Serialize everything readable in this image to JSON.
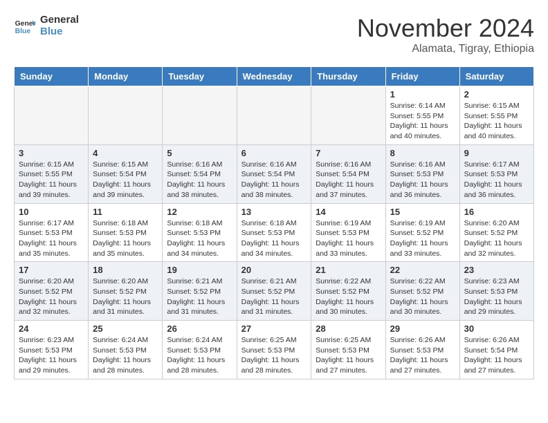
{
  "header": {
    "logo_line1": "General",
    "logo_line2": "Blue",
    "month_title": "November 2024",
    "location": "Alamata, Tigray, Ethiopia"
  },
  "weekdays": [
    "Sunday",
    "Monday",
    "Tuesday",
    "Wednesday",
    "Thursday",
    "Friday",
    "Saturday"
  ],
  "weeks": [
    [
      {
        "day": "",
        "info": ""
      },
      {
        "day": "",
        "info": ""
      },
      {
        "day": "",
        "info": ""
      },
      {
        "day": "",
        "info": ""
      },
      {
        "day": "",
        "info": ""
      },
      {
        "day": "1",
        "info": "Sunrise: 6:14 AM\nSunset: 5:55 PM\nDaylight: 11 hours\nand 40 minutes."
      },
      {
        "day": "2",
        "info": "Sunrise: 6:15 AM\nSunset: 5:55 PM\nDaylight: 11 hours\nand 40 minutes."
      }
    ],
    [
      {
        "day": "3",
        "info": "Sunrise: 6:15 AM\nSunset: 5:55 PM\nDaylight: 11 hours\nand 39 minutes."
      },
      {
        "day": "4",
        "info": "Sunrise: 6:15 AM\nSunset: 5:54 PM\nDaylight: 11 hours\nand 39 minutes."
      },
      {
        "day": "5",
        "info": "Sunrise: 6:16 AM\nSunset: 5:54 PM\nDaylight: 11 hours\nand 38 minutes."
      },
      {
        "day": "6",
        "info": "Sunrise: 6:16 AM\nSunset: 5:54 PM\nDaylight: 11 hours\nand 38 minutes."
      },
      {
        "day": "7",
        "info": "Sunrise: 6:16 AM\nSunset: 5:54 PM\nDaylight: 11 hours\nand 37 minutes."
      },
      {
        "day": "8",
        "info": "Sunrise: 6:16 AM\nSunset: 5:53 PM\nDaylight: 11 hours\nand 36 minutes."
      },
      {
        "day": "9",
        "info": "Sunrise: 6:17 AM\nSunset: 5:53 PM\nDaylight: 11 hours\nand 36 minutes."
      }
    ],
    [
      {
        "day": "10",
        "info": "Sunrise: 6:17 AM\nSunset: 5:53 PM\nDaylight: 11 hours\nand 35 minutes."
      },
      {
        "day": "11",
        "info": "Sunrise: 6:18 AM\nSunset: 5:53 PM\nDaylight: 11 hours\nand 35 minutes."
      },
      {
        "day": "12",
        "info": "Sunrise: 6:18 AM\nSunset: 5:53 PM\nDaylight: 11 hours\nand 34 minutes."
      },
      {
        "day": "13",
        "info": "Sunrise: 6:18 AM\nSunset: 5:53 PM\nDaylight: 11 hours\nand 34 minutes."
      },
      {
        "day": "14",
        "info": "Sunrise: 6:19 AM\nSunset: 5:53 PM\nDaylight: 11 hours\nand 33 minutes."
      },
      {
        "day": "15",
        "info": "Sunrise: 6:19 AM\nSunset: 5:52 PM\nDaylight: 11 hours\nand 33 minutes."
      },
      {
        "day": "16",
        "info": "Sunrise: 6:20 AM\nSunset: 5:52 PM\nDaylight: 11 hours\nand 32 minutes."
      }
    ],
    [
      {
        "day": "17",
        "info": "Sunrise: 6:20 AM\nSunset: 5:52 PM\nDaylight: 11 hours\nand 32 minutes."
      },
      {
        "day": "18",
        "info": "Sunrise: 6:20 AM\nSunset: 5:52 PM\nDaylight: 11 hours\nand 31 minutes."
      },
      {
        "day": "19",
        "info": "Sunrise: 6:21 AM\nSunset: 5:52 PM\nDaylight: 11 hours\nand 31 minutes."
      },
      {
        "day": "20",
        "info": "Sunrise: 6:21 AM\nSunset: 5:52 PM\nDaylight: 11 hours\nand 31 minutes."
      },
      {
        "day": "21",
        "info": "Sunrise: 6:22 AM\nSunset: 5:52 PM\nDaylight: 11 hours\nand 30 minutes."
      },
      {
        "day": "22",
        "info": "Sunrise: 6:22 AM\nSunset: 5:52 PM\nDaylight: 11 hours\nand 30 minutes."
      },
      {
        "day": "23",
        "info": "Sunrise: 6:23 AM\nSunset: 5:53 PM\nDaylight: 11 hours\nand 29 minutes."
      }
    ],
    [
      {
        "day": "24",
        "info": "Sunrise: 6:23 AM\nSunset: 5:53 PM\nDaylight: 11 hours\nand 29 minutes."
      },
      {
        "day": "25",
        "info": "Sunrise: 6:24 AM\nSunset: 5:53 PM\nDaylight: 11 hours\nand 28 minutes."
      },
      {
        "day": "26",
        "info": "Sunrise: 6:24 AM\nSunset: 5:53 PM\nDaylight: 11 hours\nand 28 minutes."
      },
      {
        "day": "27",
        "info": "Sunrise: 6:25 AM\nSunset: 5:53 PM\nDaylight: 11 hours\nand 28 minutes."
      },
      {
        "day": "28",
        "info": "Sunrise: 6:25 AM\nSunset: 5:53 PM\nDaylight: 11 hours\nand 27 minutes."
      },
      {
        "day": "29",
        "info": "Sunrise: 6:26 AM\nSunset: 5:53 PM\nDaylight: 11 hours\nand 27 minutes."
      },
      {
        "day": "30",
        "info": "Sunrise: 6:26 AM\nSunset: 5:54 PM\nDaylight: 11 hours\nand 27 minutes."
      }
    ]
  ],
  "colors": {
    "header_bg": "#3a7bbf",
    "alt_row": "#eef2f7"
  }
}
